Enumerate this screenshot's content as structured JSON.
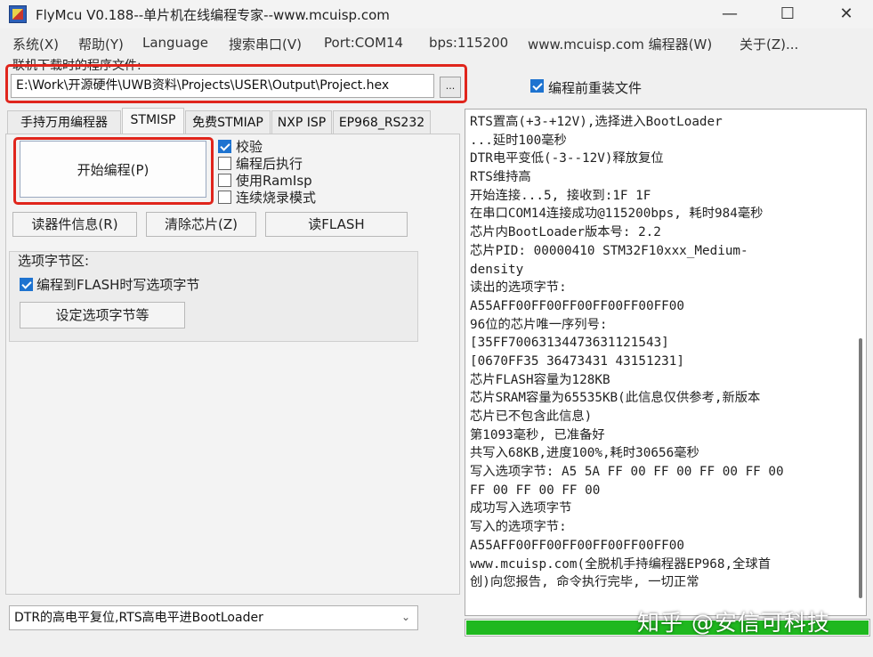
{
  "window": {
    "title": "FlyMcu V0.188--单片机在线编程专家--www.mcuisp.com",
    "minimize_glyph": "—",
    "maximize_glyph": "☐",
    "close_glyph": "✕"
  },
  "menu": [
    "系统(X)",
    "帮助(Y)",
    "Language",
    "搜索串口(V)",
    "Port:COM14",
    "bps:115200",
    "www.mcuisp.com 编程器(W)",
    "关于(Z)..."
  ],
  "file": {
    "label": "联机下载时的程序文件:",
    "path": "E:\\Work\\开源硬件\\UWB资料\\Projects\\USER\\Output\\Project.hex",
    "browse_label": "..."
  },
  "reprogram": {
    "label": "编程前重装文件",
    "checked": true
  },
  "tabs": [
    "手持万用编程器",
    "STMISP",
    "免费STMIAP",
    "NXP ISP",
    "EP968_RS232"
  ],
  "active_tab": "STMISP",
  "stmisp": {
    "start_button": "开始编程(P)",
    "options": [
      {
        "label": "校验",
        "checked": true
      },
      {
        "label": "编程后执行",
        "checked": false
      },
      {
        "label": "使用RamIsp",
        "checked": false
      },
      {
        "label": "连续烧录模式",
        "checked": false
      }
    ],
    "buttons": [
      "读器件信息(R)",
      "清除芯片(Z)",
      "读FLASH"
    ],
    "option_bytes": {
      "title": "选项字节区:",
      "write_label": "编程到FLASH时写选项字节",
      "write_checked": true,
      "settings_button": "设定选项字节等"
    }
  },
  "reset_mode": "DTR的高电平复位,RTS高电平进BootLoader",
  "log": [
    "RTS置高(+3-+12V),选择进入BootLoader",
    "...延时100毫秒",
    "DTR电平变低(-3--12V)释放复位",
    "RTS维持高",
    "开始连接...5, 接收到:1F 1F",
    "在串口COM14连接成功@115200bps, 耗时984毫秒",
    "芯片内BootLoader版本号: 2.2",
    "芯片PID: 00000410  STM32F10xxx_Medium-",
    "density",
    "读出的选项字节:",
    "A55AFF00FF00FF00FF00FF00FF00",
    "96位的芯片唯一序列号:",
    "[35FF70063134473631121543]",
    "[0670FF35 36473431 43151231]",
    "芯片FLASH容量为128KB",
    "芯片SRAM容量为65535KB(此信息仅供参考,新版本",
    "芯片已不包含此信息)",
    "第1093毫秒, 已准备好",
    "共写入68KB,进度100%,耗时30656毫秒",
    "写入选项字节: A5 5A FF 00 FF 00 FF 00 FF 00",
    "FF 00 FF 00 FF 00",
    "成功写入选项字节",
    "写入的选项字节:",
    "A55AFF00FF00FF00FF00FF00FF00",
    "www.mcuisp.com(全脱机手持编程器EP968,全球首",
    "创)向您报告, 命令执行完毕, 一切正常"
  ],
  "progress": 1.0,
  "watermark": "知乎 @安信可科技",
  "colors": {
    "accent_blue": "#1e73d0",
    "progress_green": "#1fb81f",
    "highlight_red": "#e0251c"
  }
}
